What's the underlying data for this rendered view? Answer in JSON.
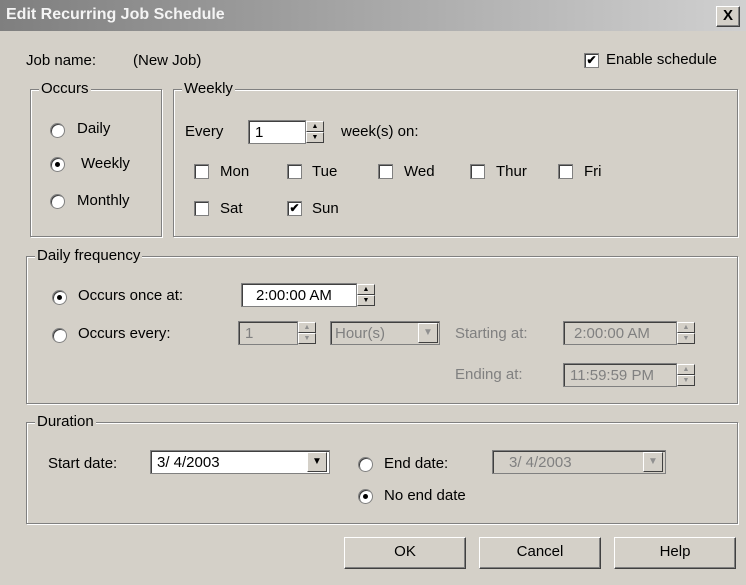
{
  "window": {
    "title": "Edit Recurring Job Schedule",
    "close_label": "X"
  },
  "job": {
    "name_label": "Job name:",
    "name_value": "(New Job)"
  },
  "enable_schedule": {
    "label": "Enable schedule",
    "checked": true,
    "mark": "✔"
  },
  "occurs": {
    "legend": "Occurs",
    "options": [
      {
        "label": "Daily",
        "selected": false
      },
      {
        "label": "Weekly",
        "selected": true
      },
      {
        "label": "Monthly",
        "selected": false
      }
    ]
  },
  "weekly": {
    "legend": "Weekly",
    "every_label": "Every",
    "every_value": "1",
    "weeks_on_label": "week(s) on:",
    "days": [
      {
        "label": "Mon",
        "checked": false
      },
      {
        "label": "Tue",
        "checked": false
      },
      {
        "label": "Wed",
        "checked": false
      },
      {
        "label": "Thur",
        "checked": false
      },
      {
        "label": "Fri",
        "checked": false
      },
      {
        "label": "Sat",
        "checked": false
      },
      {
        "label": "Sun",
        "checked": true
      }
    ]
  },
  "daily_frequency": {
    "legend": "Daily frequency",
    "once_label": "Occurs once at:",
    "once_time": "2:00:00 AM",
    "every_label": "Occurs every:",
    "every_value": "1",
    "every_unit": "Hour(s)",
    "starting_label": "Starting at:",
    "starting_value": "2:00:00 AM",
    "ending_label": "Ending at:",
    "ending_value": "11:59:59 PM",
    "mode": "once"
  },
  "duration": {
    "legend": "Duration",
    "start_label": "Start date:",
    "start_value": "3/  4/2003",
    "end_label": "End date:",
    "end_value": "3/  4/2003",
    "no_end_label": "No end date",
    "mode": "no_end"
  },
  "buttons": {
    "ok": "OK",
    "cancel": "Cancel",
    "help": "Help"
  },
  "icons": {
    "up_arrow": "▲",
    "down_arrow": "▼",
    "dropdown": "▼"
  }
}
